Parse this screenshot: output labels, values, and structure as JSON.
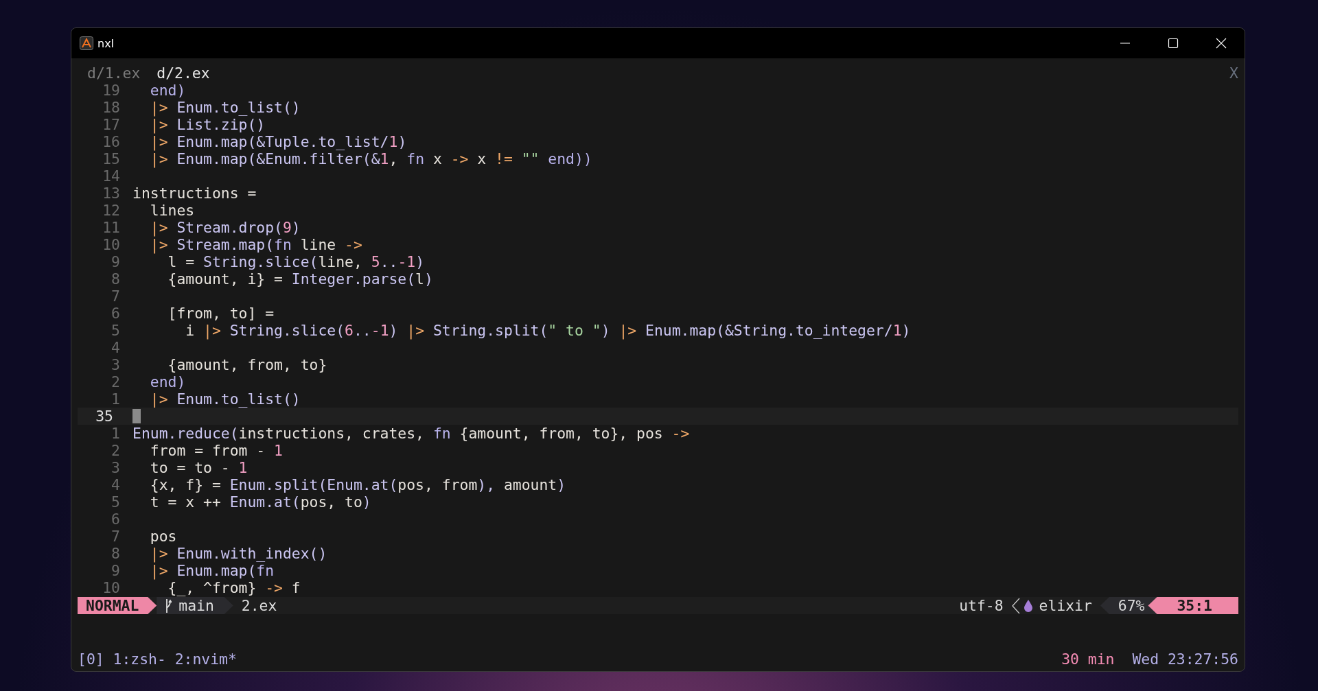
{
  "window": {
    "title": "nxl"
  },
  "buffer_tabs": [
    {
      "label": "d/1.ex",
      "selected": false
    },
    {
      "label": "d/2.ex",
      "selected": true
    }
  ],
  "close_label": "X",
  "lines": [
    {
      "number": "19",
      "current": false,
      "tokens": [
        {
          "text": "  end)",
          "kind": "kw"
        }
      ]
    },
    {
      "number": "18",
      "current": false,
      "tokens": [
        {
          "text": "  |>",
          "kind": "op"
        },
        {
          "text": " Enum.to_list()",
          "kind": "fn"
        }
      ]
    },
    {
      "number": "17",
      "current": false,
      "tokens": [
        {
          "text": "  |>",
          "kind": "op"
        },
        {
          "text": " List.zip()",
          "kind": "fn"
        }
      ]
    },
    {
      "number": "16",
      "current": false,
      "tokens": [
        {
          "text": "  |>",
          "kind": "op"
        },
        {
          "text": " Enum.map(&Tuple.to_list/",
          "kind": "fn"
        },
        {
          "text": "1",
          "kind": "num"
        },
        {
          "text": ")",
          "kind": "fn"
        }
      ]
    },
    {
      "number": "15",
      "current": false,
      "tokens": [
        {
          "text": "  |>",
          "kind": "op"
        },
        {
          "text": " Enum.map(&Enum.filter(&",
          "kind": "fn"
        },
        {
          "text": "1",
          "kind": "num"
        },
        {
          "text": ", ",
          "kind": "text"
        },
        {
          "text": "fn",
          "kind": "kw"
        },
        {
          "text": " x ",
          "kind": "text"
        },
        {
          "text": "->",
          "kind": "op"
        },
        {
          "text": " x ",
          "kind": "text"
        },
        {
          "text": "!=",
          "kind": "op"
        },
        {
          "text": " \"\"",
          "kind": "str"
        },
        {
          "text": " end))",
          "kind": "kw"
        }
      ]
    },
    {
      "number": "14",
      "current": false
    },
    {
      "number": "13",
      "current": false,
      "tokens": [
        {
          "text": "instructions =",
          "kind": "text"
        }
      ]
    },
    {
      "number": "12",
      "current": false,
      "tokens": [
        {
          "text": "  lines",
          "kind": "text"
        }
      ]
    },
    {
      "number": "11",
      "current": false,
      "tokens": [
        {
          "text": "  |>",
          "kind": "op"
        },
        {
          "text": " Stream.drop(",
          "kind": "fn"
        },
        {
          "text": "9",
          "kind": "num"
        },
        {
          "text": ")",
          "kind": "fn"
        }
      ]
    },
    {
      "number": "10",
      "current": false,
      "tokens": [
        {
          "text": "  |>",
          "kind": "op"
        },
        {
          "text": " Stream.map(",
          "kind": "fn"
        },
        {
          "text": "fn",
          "kind": "kw"
        },
        {
          "text": " line ",
          "kind": "text"
        },
        {
          "text": "->",
          "kind": "op"
        }
      ]
    },
    {
      "number": "9",
      "current": false,
      "tokens": [
        {
          "text": "    l = ",
          "kind": "text"
        },
        {
          "text": "String.slice(",
          "kind": "fn"
        },
        {
          "text": "line, ",
          "kind": "text"
        },
        {
          "text": "5",
          "kind": "num"
        },
        {
          "text": "..",
          "kind": "fn"
        },
        {
          "text": "-1",
          "kind": "num"
        },
        {
          "text": ")",
          "kind": "fn"
        }
      ]
    },
    {
      "number": "8",
      "current": false,
      "tokens": [
        {
          "text": "    {amount, i} = ",
          "kind": "text"
        },
        {
          "text": "Integer.parse(",
          "kind": "fn"
        },
        {
          "text": "l",
          "kind": "text"
        },
        {
          "text": ")",
          "kind": "fn"
        }
      ]
    },
    {
      "number": "7",
      "current": false
    },
    {
      "number": "6",
      "current": false,
      "tokens": [
        {
          "text": "    [from, to] =",
          "kind": "text"
        }
      ]
    },
    {
      "number": "5",
      "current": false,
      "tokens": [
        {
          "text": "      i ",
          "kind": "text"
        },
        {
          "text": "|>",
          "kind": "op"
        },
        {
          "text": " String.slice(",
          "kind": "fn"
        },
        {
          "text": "6",
          "kind": "num"
        },
        {
          "text": "..",
          "kind": "fn"
        },
        {
          "text": "-1",
          "kind": "num"
        },
        {
          "text": ") ",
          "kind": "fn"
        },
        {
          "text": "|>",
          "kind": "op"
        },
        {
          "text": " String.split(",
          "kind": "fn"
        },
        {
          "text": "\" to \"",
          "kind": "str"
        },
        {
          "text": ") ",
          "kind": "fn"
        },
        {
          "text": "|>",
          "kind": "op"
        },
        {
          "text": " Enum.map(&String.to_integer/",
          "kind": "fn"
        },
        {
          "text": "1",
          "kind": "num"
        },
        {
          "text": ")",
          "kind": "fn"
        }
      ]
    },
    {
      "number": "4",
      "current": false
    },
    {
      "number": "3",
      "current": false,
      "tokens": [
        {
          "text": "    {amount, from, to}",
          "kind": "text"
        }
      ]
    },
    {
      "number": "2",
      "current": false,
      "tokens": [
        {
          "text": "  end)",
          "kind": "kw"
        }
      ]
    },
    {
      "number": "1",
      "current": false,
      "tokens": [
        {
          "text": "  |>",
          "kind": "op"
        },
        {
          "text": " Enum.to_list()",
          "kind": "fn"
        }
      ]
    },
    {
      "number": "35",
      "current": true
    },
    {
      "number": "1",
      "current": false,
      "tokens": [
        {
          "text": "Enum.reduce(",
          "kind": "fn"
        },
        {
          "text": "instructions, crates, ",
          "kind": "text"
        },
        {
          "text": "fn",
          "kind": "kw"
        },
        {
          "text": " {amount, from, to}, pos ",
          "kind": "text"
        },
        {
          "text": "->",
          "kind": "op"
        }
      ]
    },
    {
      "number": "2",
      "current": false,
      "tokens": [
        {
          "text": "  from = from - ",
          "kind": "text"
        },
        {
          "text": "1",
          "kind": "num"
        }
      ]
    },
    {
      "number": "3",
      "current": false,
      "tokens": [
        {
          "text": "  to = to - ",
          "kind": "text"
        },
        {
          "text": "1",
          "kind": "num"
        }
      ]
    },
    {
      "number": "4",
      "current": false,
      "tokens": [
        {
          "text": "  {x, f} = ",
          "kind": "text"
        },
        {
          "text": "Enum.split(Enum.at(",
          "kind": "fn"
        },
        {
          "text": "pos, from",
          "kind": "text"
        },
        {
          "text": "), ",
          "kind": "fn"
        },
        {
          "text": "amount",
          "kind": "text"
        },
        {
          "text": ")",
          "kind": "fn"
        }
      ]
    },
    {
      "number": "5",
      "current": false,
      "tokens": [
        {
          "text": "  t = x ++ ",
          "kind": "text"
        },
        {
          "text": "Enum.at(",
          "kind": "fn"
        },
        {
          "text": "pos, to",
          "kind": "text"
        },
        {
          "text": ")",
          "kind": "fn"
        }
      ]
    },
    {
      "number": "6",
      "current": false
    },
    {
      "number": "7",
      "current": false,
      "tokens": [
        {
          "text": "  pos",
          "kind": "text"
        }
      ]
    },
    {
      "number": "8",
      "current": false,
      "tokens": [
        {
          "text": "  |>",
          "kind": "op"
        },
        {
          "text": " Enum.with_index()",
          "kind": "fn"
        }
      ]
    },
    {
      "number": "9",
      "current": false,
      "tokens": [
        {
          "text": "  |>",
          "kind": "op"
        },
        {
          "text": " Enum.map(",
          "kind": "fn"
        },
        {
          "text": "fn",
          "kind": "kw"
        }
      ]
    },
    {
      "number": "10",
      "current": false,
      "tokens": [
        {
          "text": "    {_, ^from} ",
          "kind": "text"
        },
        {
          "text": "->",
          "kind": "op"
        },
        {
          "text": " f",
          "kind": "text"
        }
      ]
    }
  ],
  "status_line": {
    "mode": "NORMAL",
    "branch": "main",
    "file": "2.ex",
    "encoding": "utf-8",
    "filetype": "elixir",
    "progress": "67%",
    "position": "35:1"
  },
  "tmux": {
    "windows": "[0] 1:zsh- 2:nvim*",
    "timer": "30 min",
    "clock": "Wed 23:27:56"
  }
}
